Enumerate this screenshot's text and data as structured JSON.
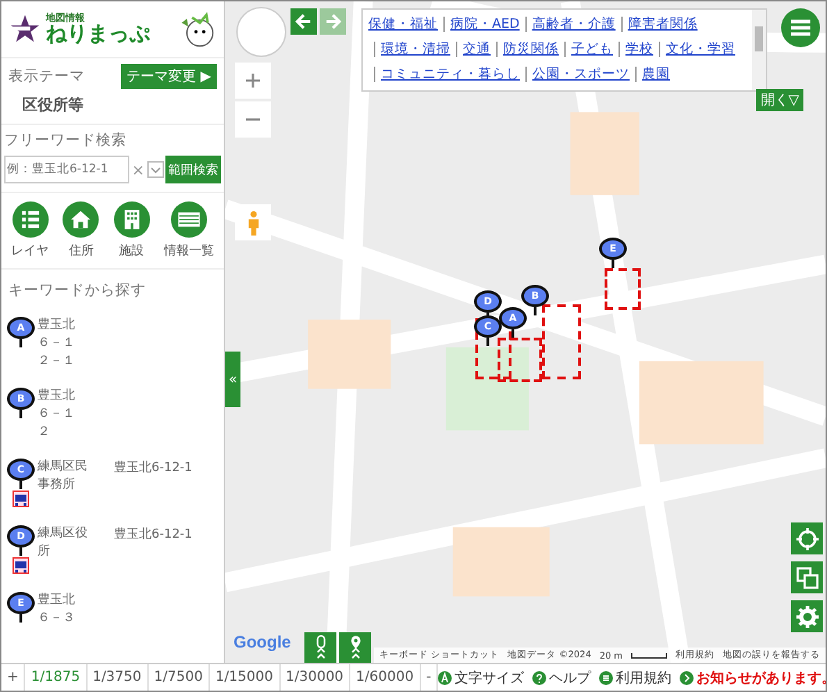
{
  "header": {
    "caption": "地図情報",
    "title": "ねりまっぷ"
  },
  "theme": {
    "label": "表示テーマ",
    "button": "テーマ変更 ▶",
    "value": "区役所等"
  },
  "search": {
    "label": "フリーワード検索",
    "placeholder": "例：豊玉北6-12-1",
    "clear": "×",
    "button": "範囲検索"
  },
  "tools": [
    {
      "kind": "layer",
      "label": "レイヤ"
    },
    {
      "kind": "address",
      "label": "住所"
    },
    {
      "kind": "facility",
      "label": "施設"
    },
    {
      "kind": "list",
      "label": "情報一覧"
    }
  ],
  "keyword": {
    "heading": "キーワードから探す",
    "results": [
      {
        "letter": "A",
        "name": "豊玉北６－１２－１",
        "kind": "address"
      },
      {
        "letter": "B",
        "name": "豊玉北６－１２",
        "kind": "address"
      },
      {
        "letter": "C",
        "name": "練馬区民事務所",
        "address": "豊玉北6-12-1",
        "kind": "facility"
      },
      {
        "letter": "D",
        "name": "練馬区役所",
        "address": "豊玉北6-12-1",
        "kind": "facility"
      },
      {
        "letter": "E",
        "name": "豊玉北６－３",
        "kind": "address"
      }
    ]
  },
  "map": {
    "history": [
      {
        "kind": "back",
        "disabled": false
      },
      {
        "kind": "forward",
        "disabled": true
      }
    ],
    "categories": [
      "保健・福祉",
      "病院・AED",
      "高齢者・介護",
      "障害者関係",
      "環境・清掃",
      "交通",
      "防災関係",
      "子ども",
      "学校",
      "文化・学習",
      "コミュニティ・暮らし",
      "公園・スポーツ",
      "農園"
    ],
    "open_button": "開く▽",
    "collapse": "«",
    "markers": [
      {
        "letter": "E"
      },
      {
        "letter": "B"
      },
      {
        "letter": "D"
      },
      {
        "letter": "A"
      },
      {
        "letter": "C"
      }
    ],
    "attribution": {
      "logo": "Google",
      "shortcuts": "キーボード ショートカット",
      "data": "地図データ ©2024",
      "scale": "20 m",
      "terms": "利用規約",
      "report": "地図の誤りを報告する"
    }
  },
  "footer": {
    "zoom_in": "+",
    "scales": [
      {
        "label": "1/1875",
        "selected": true
      },
      {
        "label": "1/3750",
        "selected": false
      },
      {
        "label": "1/7500",
        "selected": false
      },
      {
        "label": "1/15000",
        "selected": false
      },
      {
        "label": "1/30000",
        "selected": false
      },
      {
        "label": "1/60000",
        "selected": false
      }
    ],
    "zoom_out": "-",
    "links": [
      {
        "kind": "text-size",
        "label": "文字サイズ"
      },
      {
        "kind": "help",
        "label": "ヘルプ"
      },
      {
        "kind": "terms",
        "label": "利用規約"
      },
      {
        "kind": "notice",
        "label": "お知らせがあります。"
      }
    ]
  }
}
